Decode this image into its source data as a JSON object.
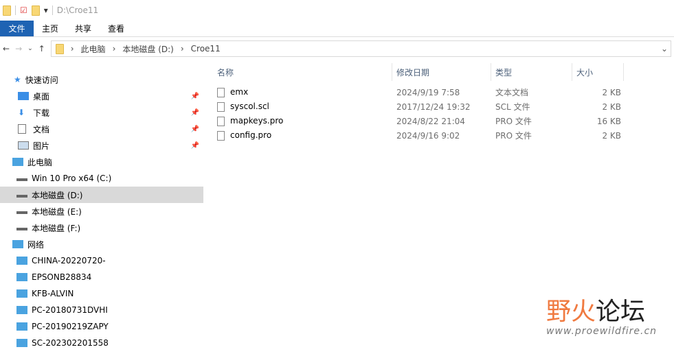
{
  "title": "D:\\Croe11",
  "ribbon": {
    "tabs": [
      "文件",
      "主页",
      "共享",
      "查看"
    ]
  },
  "address": {
    "crumbs": [
      "此电脑",
      "本地磁盘 (D:)",
      "Croe11"
    ]
  },
  "nav": {
    "quick": "快速访问",
    "quick_items": [
      "桌面",
      "下载",
      "文档",
      "图片"
    ],
    "pc": "此电脑",
    "drives": [
      "Win 10 Pro x64 (C:)",
      "本地磁盘 (D:)",
      "本地磁盘 (E:)",
      "本地磁盘 (F:)"
    ],
    "network": "网络",
    "hosts": [
      "CHINA-20220720-",
      "EPSONB28834",
      "KFB-ALVIN",
      "PC-20180731DVHI",
      "PC-20190219ZAPY",
      "SC-202302201558"
    ]
  },
  "columns": {
    "name": "名称",
    "date": "修改日期",
    "type": "类型",
    "size": "大小"
  },
  "files": [
    {
      "name": "emx",
      "date": "2024/9/19 7:58",
      "type": "文本文档",
      "size": "2 KB"
    },
    {
      "name": "syscol.scl",
      "date": "2017/12/24 19:32",
      "type": "SCL 文件",
      "size": "2 KB"
    },
    {
      "name": "mapkeys.pro",
      "date": "2024/8/22 21:04",
      "type": "PRO 文件",
      "size": "16 KB"
    },
    {
      "name": "config.pro",
      "date": "2024/9/16 9:02",
      "type": "PRO 文件",
      "size": "2 KB"
    }
  ],
  "watermark": {
    "brand": "野火论坛",
    "url": "www.proewildfire.cn"
  }
}
